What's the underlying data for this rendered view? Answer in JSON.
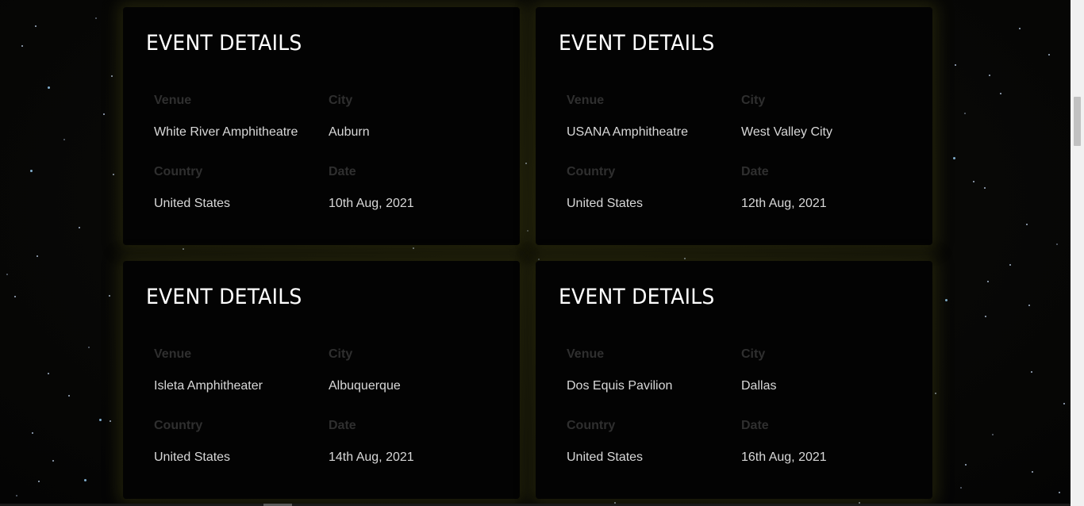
{
  "events": [
    {
      "title": "EVENT DETAILS",
      "venue_label": "Venue",
      "venue": "White River Amphitheatre",
      "city_label": "City",
      "city": "Auburn",
      "country_label": "Country",
      "country": "United States",
      "date_label": "Date",
      "date": "10th Aug, 2021"
    },
    {
      "title": "EVENT DETAILS",
      "venue_label": "Venue",
      "venue": "USANA Amphitheatre",
      "city_label": "City",
      "city": "West Valley City",
      "country_label": "Country",
      "country": "United States",
      "date_label": "Date",
      "date": "12th Aug, 2021"
    },
    {
      "title": "EVENT DETAILS",
      "venue_label": "Venue",
      "venue": "Isleta Amphitheater",
      "city_label": "City",
      "city": "Albuquerque",
      "country_label": "Country",
      "country": "United States",
      "date_label": "Date",
      "date": "14th Aug, 2021"
    },
    {
      "title": "EVENT DETAILS",
      "venue_label": "Venue",
      "venue": "Dos Equis Pavilion",
      "city_label": "City",
      "city": "Dallas",
      "country_label": "Country",
      "country": "United States",
      "date_label": "Date",
      "date": "16th Aug, 2021"
    }
  ],
  "colors": {
    "card_background": "#030303",
    "title": "#ffffff",
    "label": "#2f2f2f",
    "value": "#d8d8d8",
    "page_background": "#060605",
    "card_glow": "#34340e"
  }
}
